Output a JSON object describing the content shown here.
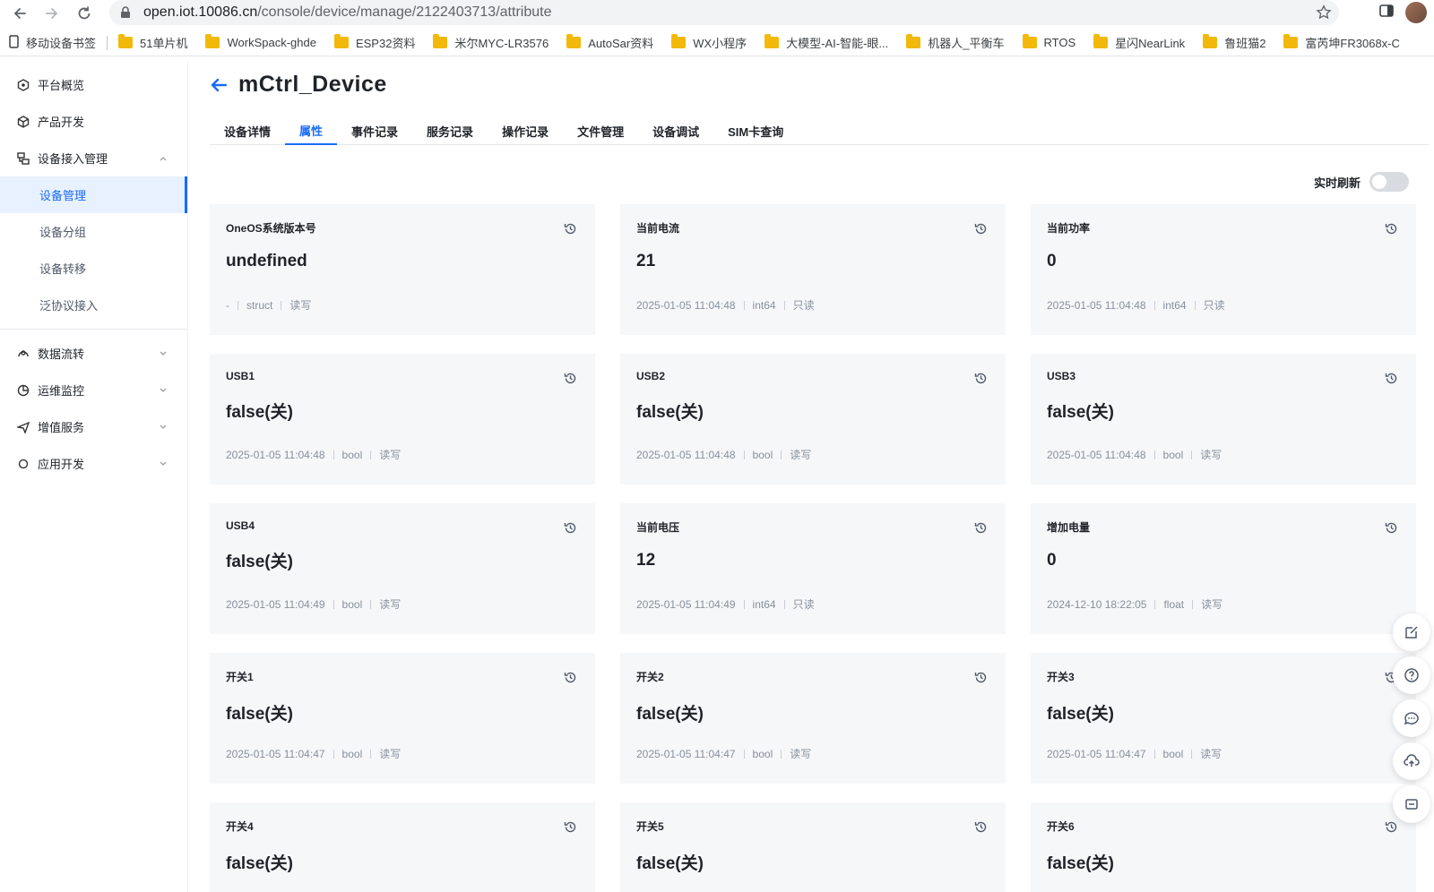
{
  "browser": {
    "url_host": "open.iot.10086.cn",
    "url_path": "/console/device/manage/2122403713/attribute",
    "bookmarks": [
      "移动设备书签",
      "51单片机",
      "WorkSpack-ghde",
      "ESP32资料",
      "米尔MYC-LR3576",
      "AutoSar资料",
      "WX小程序",
      "大模型-AI-智能-眼...",
      "机器人_平衡车",
      "RTOS",
      "星闪NearLink",
      "鲁班猫2",
      "富芮坤FR3068x-C"
    ]
  },
  "sidebar": {
    "items": [
      {
        "label": "平台概览",
        "icon": "overview-icon"
      },
      {
        "label": "产品开发",
        "icon": "cube-icon"
      },
      {
        "label": "设备接入管理",
        "icon": "device-access-icon",
        "expanded": true
      }
    ],
    "sub_items": [
      "设备管理",
      "设备分组",
      "设备转移",
      "泛协议接入"
    ],
    "active_sub": "设备管理",
    "bottom_items": [
      {
        "label": "数据流转",
        "icon": "data-flow-icon"
      },
      {
        "label": "运维监控",
        "icon": "monitor-icon"
      },
      {
        "label": "增值服务",
        "icon": "send-icon"
      },
      {
        "label": "应用开发",
        "icon": "app-dev-icon"
      }
    ]
  },
  "page": {
    "title": "mCtrl_Device",
    "tabs": [
      "设备详情",
      "属性",
      "事件记录",
      "服务记录",
      "操作记录",
      "文件管理",
      "设备调试",
      "SIM卡查询"
    ],
    "active_tab": "属性",
    "realtime_refresh_label": "实时刷新",
    "realtime_refresh_on": false
  },
  "cards": [
    {
      "name": "OneOS系统版本号",
      "value": "undefined",
      "time": "-",
      "type": "struct",
      "access": "读写"
    },
    {
      "name": "当前电流",
      "value": "21",
      "time": "2025-01-05 11:04:48",
      "type": "int64",
      "access": "只读"
    },
    {
      "name": "当前功率",
      "value": "0",
      "time": "2025-01-05 11:04:48",
      "type": "int64",
      "access": "只读"
    },
    {
      "name": "USB1",
      "value": "false(关)",
      "time": "2025-01-05 11:04:48",
      "type": "bool",
      "access": "读写"
    },
    {
      "name": "USB2",
      "value": "false(关)",
      "time": "2025-01-05 11:04:48",
      "type": "bool",
      "access": "读写"
    },
    {
      "name": "USB3",
      "value": "false(关)",
      "time": "2025-01-05 11:04:48",
      "type": "bool",
      "access": "读写"
    },
    {
      "name": "USB4",
      "value": "false(关)",
      "time": "2025-01-05 11:04:49",
      "type": "bool",
      "access": "读写"
    },
    {
      "name": "当前电压",
      "value": "12",
      "time": "2025-01-05 11:04:49",
      "type": "int64",
      "access": "只读"
    },
    {
      "name": "增加电量",
      "value": "0",
      "time": "2024-12-10 18:22:05",
      "type": "float",
      "access": "读写"
    },
    {
      "name": "开关1",
      "value": "false(关)",
      "time": "2025-01-05 11:04:47",
      "type": "bool",
      "access": "读写"
    },
    {
      "name": "开关2",
      "value": "false(关)",
      "time": "2025-01-05 11:04:47",
      "type": "bool",
      "access": "读写"
    },
    {
      "name": "开关3",
      "value": "false(关)",
      "time": "2025-01-05 11:04:47",
      "type": "bool",
      "access": "读写"
    },
    {
      "name": "开关4",
      "value": "false(关)",
      "time": "",
      "type": "",
      "access": ""
    },
    {
      "name": "开关5",
      "value": "false(关)",
      "time": "",
      "type": "",
      "access": ""
    },
    {
      "name": "开关6",
      "value": "false(关)",
      "time": "",
      "type": "",
      "access": ""
    }
  ],
  "colors": {
    "accent": "#1a6bf5",
    "card_bg": "#f6f7f9",
    "meta_text": "#86909c"
  }
}
